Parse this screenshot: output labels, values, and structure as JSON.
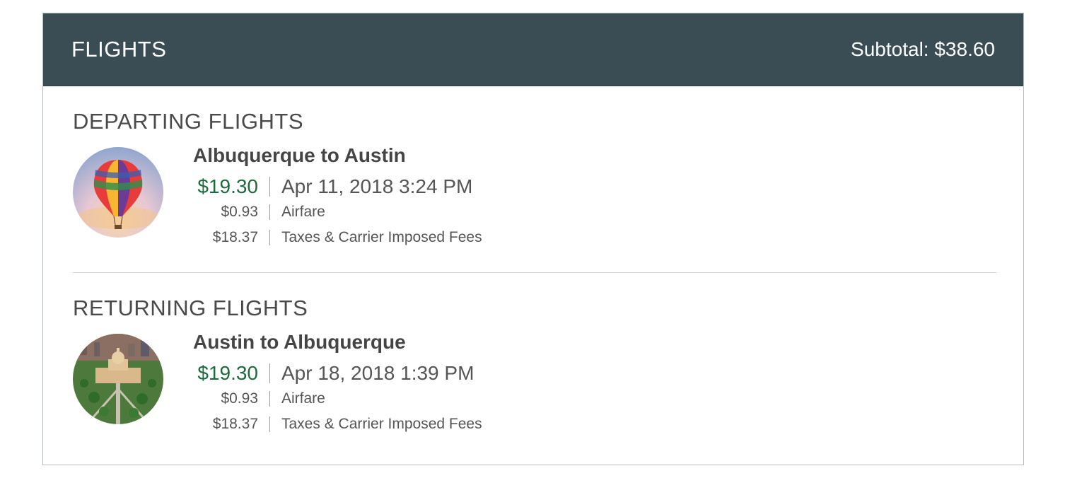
{
  "header": {
    "title": "FLIGHTS",
    "subtotal": "Subtotal: $38.60"
  },
  "departing": {
    "section_title": "DEPARTING FLIGHTS",
    "image": "hot-air-balloon-image",
    "route": "Albuquerque to Austin",
    "price": "$19.30",
    "datetime": "Apr 11, 2018 3:24 PM",
    "airfare_amount": "$0.93",
    "airfare_label": "Airfare",
    "fees_amount": "$18.37",
    "fees_label": "Taxes & Carrier Imposed Fees"
  },
  "returning": {
    "section_title": "RETURNING FLIGHTS",
    "image": "austin-capitol-image",
    "route": "Austin to Albuquerque",
    "price": "$19.30",
    "datetime": "Apr 18, 2018 1:39 PM",
    "airfare_amount": "$0.93",
    "airfare_label": "Airfare",
    "fees_amount": "$18.37",
    "fees_label": "Taxes & Carrier Imposed Fees"
  },
  "colors": {
    "header_bg": "#3b4d54",
    "price_green": "#1b6b3c"
  }
}
